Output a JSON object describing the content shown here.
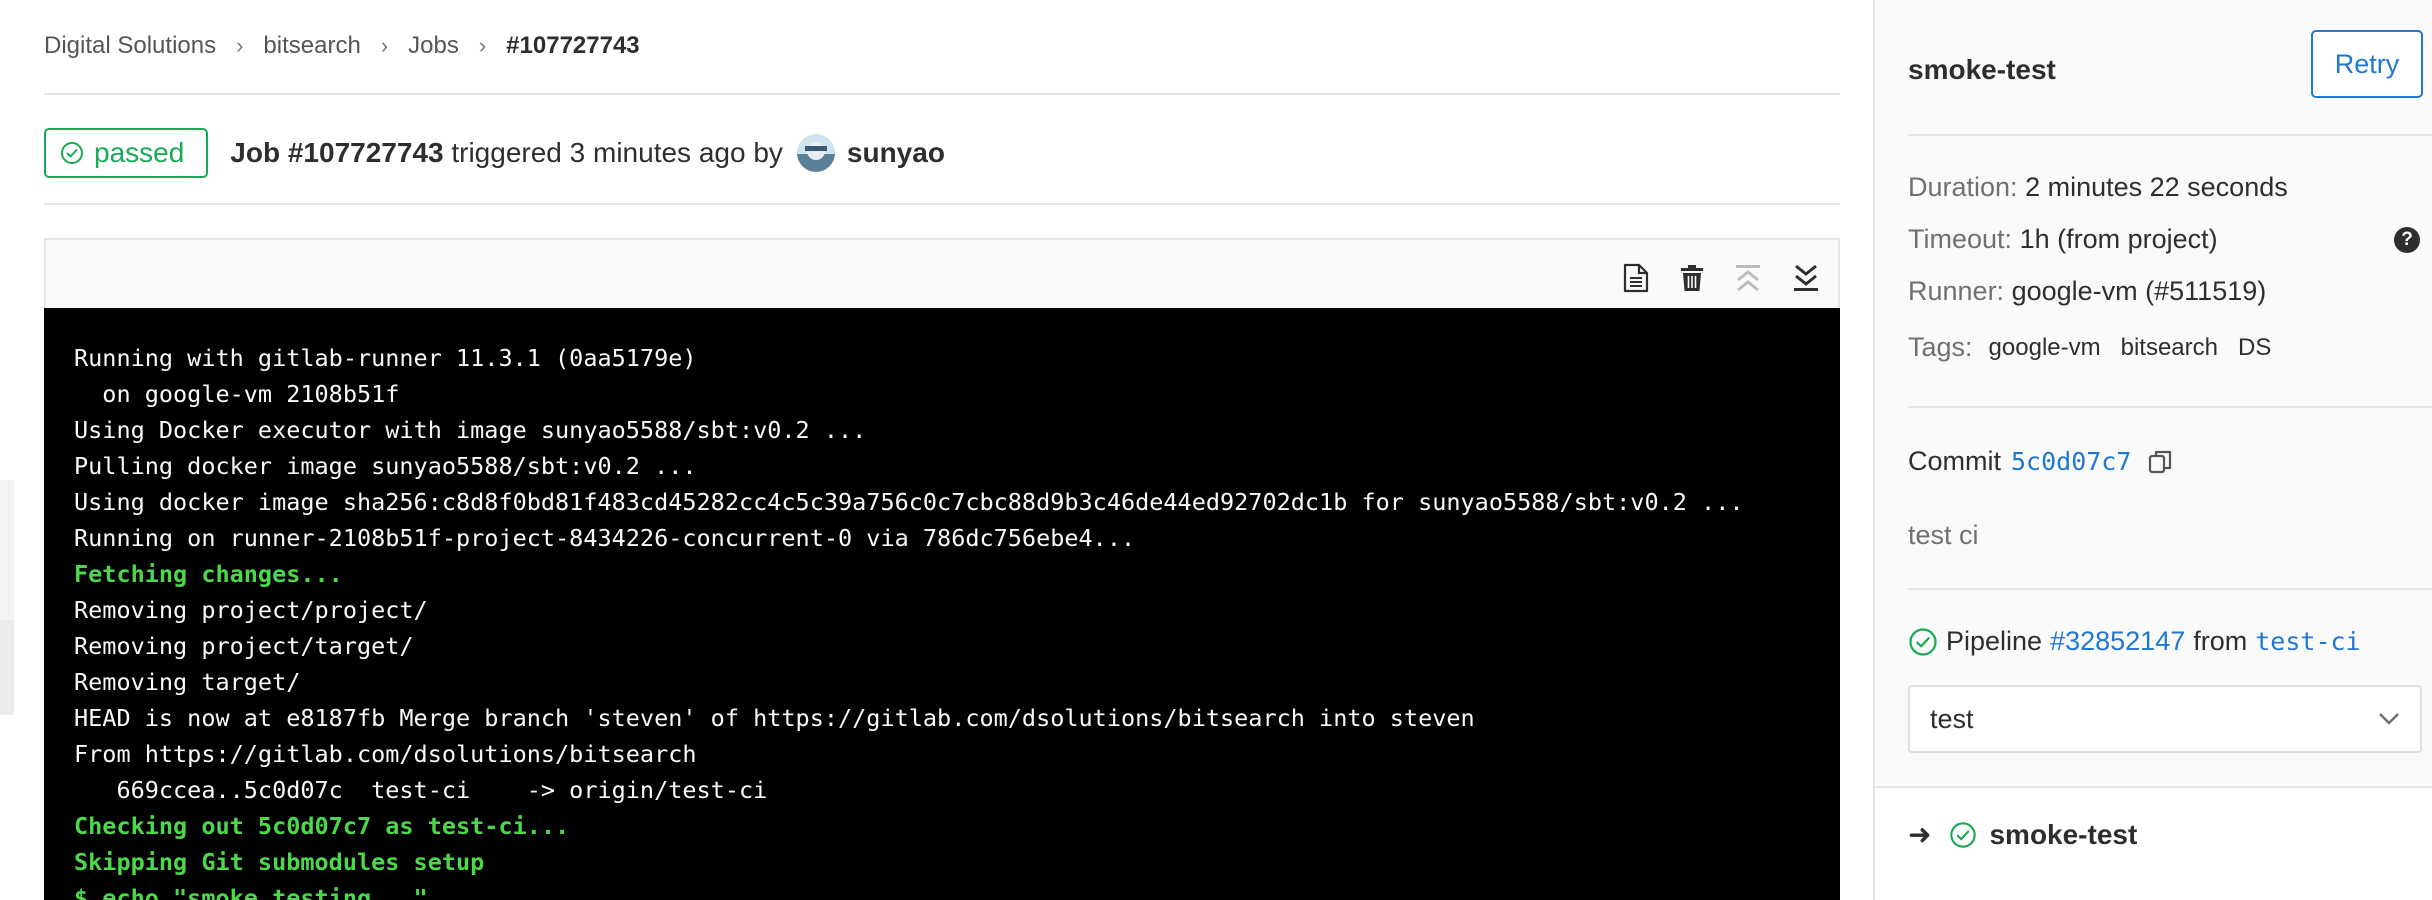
{
  "breadcrumb": {
    "items": [
      "Digital Solutions",
      "bitsearch",
      "Jobs"
    ],
    "current": "#107727743"
  },
  "job_header": {
    "status": "passed",
    "job_label": "Job #107727743",
    "triggered_text": "triggered 3 minutes ago by",
    "username": "sunyao"
  },
  "toolbar": {
    "icons": [
      "raw-log-icon",
      "erase-log-icon",
      "scroll-top-icon",
      "scroll-bottom-icon"
    ]
  },
  "log": {
    "lines": [
      {
        "text": "Running with gitlab-runner 11.3.1 (0aa5179e)",
        "color": "default"
      },
      {
        "text": "  on google-vm 2108b51f",
        "color": "default"
      },
      {
        "text": "Using Docker executor with image sunyao5588/sbt:v0.2 ...",
        "color": "default"
      },
      {
        "text": "Pulling docker image sunyao5588/sbt:v0.2 ...",
        "color": "default"
      },
      {
        "text": "Using docker image sha256:c8d8f0bd81f483cd45282cc4c5c39a756c0c7cbc88d9b3c46de44ed92702dc1b for sunyao5588/sbt:v0.2 ...",
        "color": "default"
      },
      {
        "text": "Running on runner-2108b51f-project-8434226-concurrent-0 via 786dc756ebe4...",
        "color": "default"
      },
      {
        "text": "Fetching changes...",
        "color": "green"
      },
      {
        "text": "Removing project/project/",
        "color": "default"
      },
      {
        "text": "Removing project/target/",
        "color": "default"
      },
      {
        "text": "Removing target/",
        "color": "default"
      },
      {
        "text": "HEAD is now at e8187fb Merge branch 'steven' of https://gitlab.com/dsolutions/bitsearch into steven",
        "color": "default"
      },
      {
        "text": "From https://gitlab.com/dsolutions/bitsearch",
        "color": "default"
      },
      {
        "text": "   669ccea..5c0d07c  test-ci    -> origin/test-ci",
        "color": "default"
      },
      {
        "text": "Checking out 5c0d07c7 as test-ci...",
        "color": "green"
      },
      {
        "text": "Skipping Git submodules setup",
        "color": "green"
      },
      {
        "text": "$ echo \"smoke testing...\"",
        "color": "green"
      }
    ]
  },
  "sidebar": {
    "title": "smoke-test",
    "retry_label": "Retry",
    "duration_label": "Duration:",
    "duration_value": "2 minutes 22 seconds",
    "timeout_label": "Timeout:",
    "timeout_value": "1h (from project)",
    "help_glyph": "?",
    "runner_label": "Runner:",
    "runner_value": "google-vm (#511519)",
    "tags_label": "Tags:",
    "tags": [
      "google-vm",
      "bitsearch",
      "DS"
    ],
    "commit_label": "Commit",
    "commit_sha": "5c0d07c7",
    "commit_message": "test ci",
    "pipeline_label": "Pipeline",
    "pipeline_id": "#32852147",
    "pipeline_from": "from",
    "pipeline_branch": "test-ci",
    "stage_selected": "test",
    "job_item": "smoke-test"
  },
  "colors": {
    "success": "#1aaa55",
    "link": "#1f78d1",
    "log_green": "#4bd84b"
  }
}
